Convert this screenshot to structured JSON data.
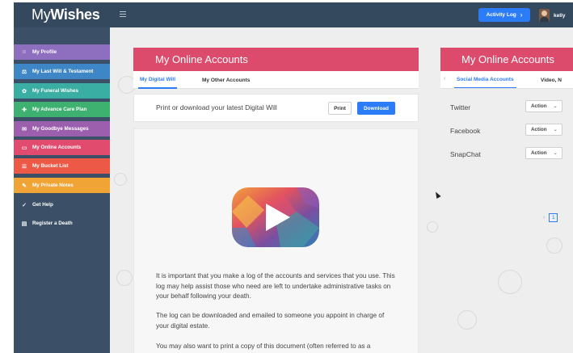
{
  "app": {
    "logo_part1": "My",
    "logo_part2": "Wishes",
    "activity_log": "Activity Log",
    "activity_chevron": "›",
    "username": "kelly"
  },
  "sidebar": {
    "items": [
      {
        "label": "My Profile",
        "icon": "☺",
        "color": "#8e6fbf"
      },
      {
        "label": "My Last Will & Testament",
        "icon": "⚖",
        "color": "#3f86c6"
      },
      {
        "label": "My Funeral Wishes",
        "icon": "✿",
        "color": "#3aaea3"
      },
      {
        "label": "My Advance Care Plan",
        "icon": "✚",
        "color": "#3eb06f"
      },
      {
        "label": "My Goodbye Messages",
        "icon": "✉",
        "color": "#9b5fae"
      },
      {
        "label": "My Online Accounts",
        "icon": "▭",
        "color": "#e14c6e"
      },
      {
        "label": "My Bucket List",
        "icon": "☰",
        "color": "#ec5a47"
      },
      {
        "label": "My Private Notes",
        "icon": "✎",
        "color": "#f0a436"
      },
      {
        "label": "Get Help",
        "icon": "✓",
        "color": "#3b5066"
      },
      {
        "label": "Register a Death",
        "icon": "▤",
        "color": "#3b5066"
      }
    ]
  },
  "center": {
    "title": "My Online Accounts",
    "tabs": [
      "My Digital Will",
      "My Other Accounts"
    ],
    "print_message": "Print or download your latest Digital Will",
    "print_label": "Print",
    "download_label": "Download",
    "paragraphs": [
      "It is important that you make a log of the accounts and services that you use. This log may help assist those who need are left to undertake administrative tasks on your behalf following your death.",
      "The log can be downloaded and emailed to someone you appoint in charge of your digital estate.",
      "You may also want to print a copy of this document (often referred to as a"
    ]
  },
  "right": {
    "title": "My Online Accounts",
    "tabs": [
      "Social Media Accounts",
      "Video, N"
    ],
    "prev_arrow": "‹",
    "accounts": [
      {
        "name": "Twitter",
        "action": "Action"
      },
      {
        "name": "Facebook",
        "action": "Action"
      },
      {
        "name": "SnapChat",
        "action": "Action"
      }
    ],
    "page": "1"
  },
  "colors": {
    "topbar": "#34495e",
    "sidebar": "#3b5066",
    "banner": "#dd4b6c",
    "accent": "#2b7cf6"
  }
}
